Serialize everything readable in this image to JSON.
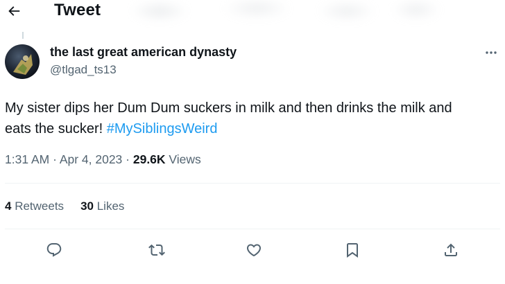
{
  "header": {
    "title": "Tweet",
    "back_icon": "arrow-left-icon"
  },
  "author": {
    "name": "the last great american dynasty",
    "handle": "@tlgad_ts13",
    "avatar_icon": "avatar"
  },
  "tweet": {
    "text_line1": "My sister dips her Dum Dum suckers in milk and then drinks the milk and",
    "text_line2": "eats the sucker! ",
    "hashtag": "#MySiblingsWeird",
    "hashtag_color": "#1d9bf0"
  },
  "meta": {
    "time": "1:31 AM",
    "separator": " · ",
    "date": "Apr 4, 2023",
    "views_count": "29.6K",
    "views_label": " Views"
  },
  "stats": {
    "retweets_count": "4",
    "retweets_label": " Retweets",
    "likes_count": "30",
    "likes_label": " Likes"
  },
  "actions": [
    "reply-icon",
    "retweet-icon",
    "like-icon",
    "bookmark-icon",
    "share-icon"
  ]
}
